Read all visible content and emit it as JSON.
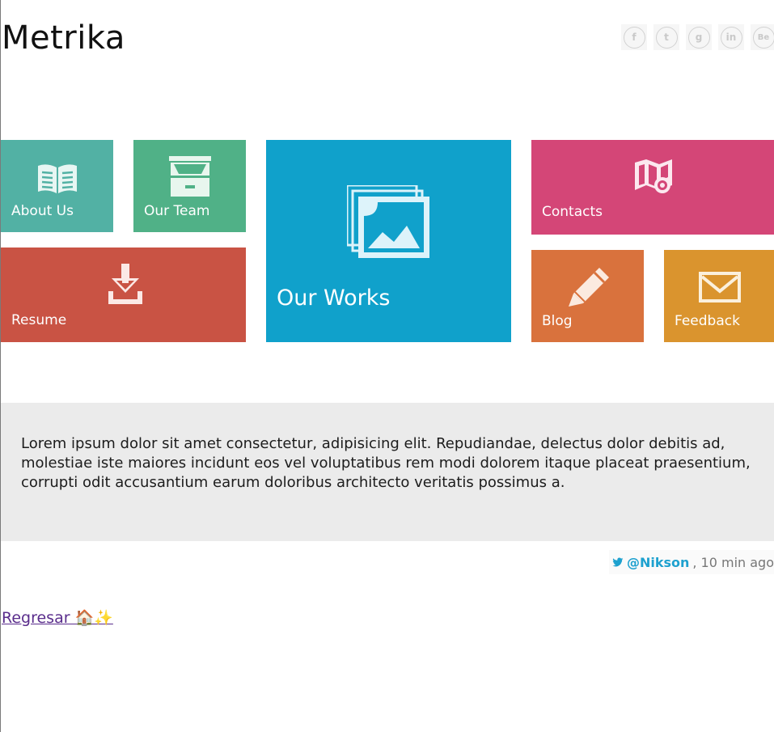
{
  "header": {
    "title": "Metrika"
  },
  "social": [
    {
      "name": "facebook",
      "glyph": "f"
    },
    {
      "name": "twitter",
      "glyph": "t"
    },
    {
      "name": "googleplus",
      "glyph": "g"
    },
    {
      "name": "linkedin",
      "glyph": "in"
    },
    {
      "name": "behance",
      "glyph": "Be"
    }
  ],
  "tiles": {
    "about": {
      "label": "About Us",
      "icon": "book-icon",
      "color": "#52b1a4"
    },
    "team": {
      "label": "Our Team",
      "icon": "cabinet-icon",
      "color": "#50b187"
    },
    "resume": {
      "label": "Resume",
      "icon": "download-icon",
      "color": "#c95344"
    },
    "works": {
      "label": "Our Works",
      "icon": "gallery-icon",
      "color": "#10a1cb"
    },
    "contacts": {
      "label": "Contacts",
      "icon": "map-icon",
      "color": "#d44677"
    },
    "blog": {
      "label": "Blog",
      "icon": "pencil-icon",
      "color": "#d9723d"
    },
    "feedback": {
      "label": "Feedback",
      "icon": "mail-icon",
      "color": "#da942e"
    }
  },
  "quote": {
    "text": "Lorem ipsum dolor sit amet consectetur, adipisicing elit. Repudiandae, delectus dolor debitis ad, molestiae iste maiores incidunt eos vel voluptatibus rem modi dolorem itaque placeat praesentium, corrupti odit accusantium earum doloribus architecto veritatis possimus a."
  },
  "tweet": {
    "handle": "@Nikson",
    "time": ", 10 min ago"
  },
  "footer": {
    "back_link": "Regresar 🏠✨"
  }
}
